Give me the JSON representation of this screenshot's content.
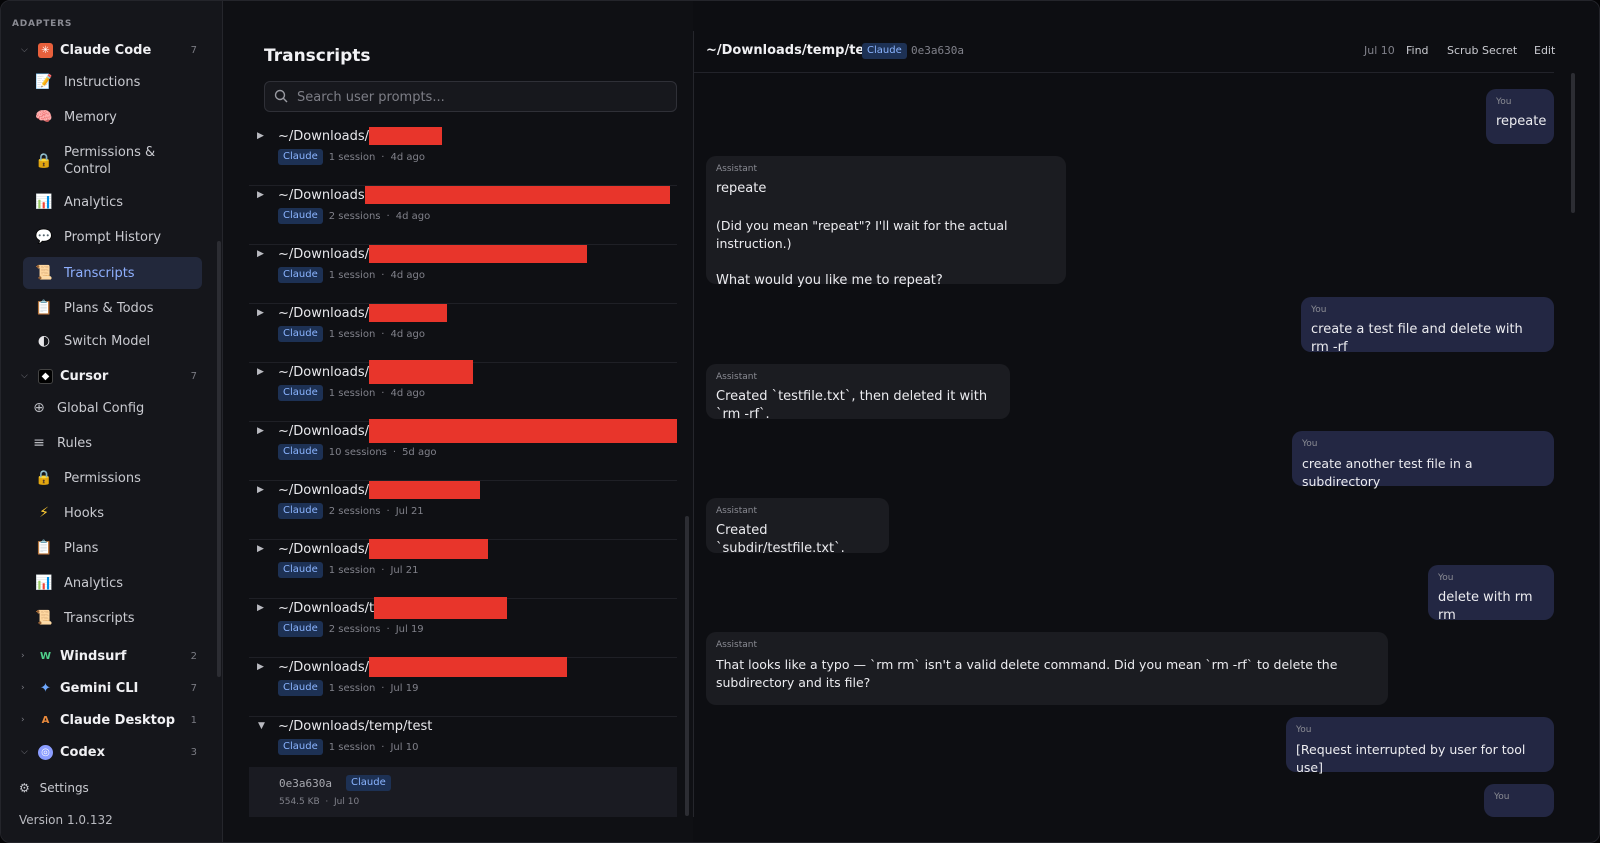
{
  "sidebar": {
    "heading": "ADAPTERS",
    "groups": [
      {
        "label": "Claude Code",
        "count": "7",
        "icon": "claude-code-icon",
        "color": "#e8603c"
      },
      {
        "label": "Cursor",
        "count": "7",
        "icon": "cursor-icon",
        "color": "#ffffff"
      },
      {
        "label": "Windsurf",
        "count": "2",
        "icon": "windsurf-icon",
        "color": "#4fd08b"
      },
      {
        "label": "Gemini CLI",
        "count": "7",
        "icon": "gemini-icon",
        "color": "#6ea8ff"
      },
      {
        "label": "Claude Desktop",
        "count": "1",
        "icon": "claude-desktop-icon",
        "color": "#e98a3c"
      },
      {
        "label": "Codex",
        "count": "3",
        "icon": "codex-icon",
        "color": "#8b9dff"
      }
    ],
    "claude_items": [
      {
        "label": "Instructions",
        "icon": "memo-icon"
      },
      {
        "label": "Memory",
        "icon": "brain-icon"
      },
      {
        "label": "Permissions & Control",
        "icon": "lock-icon"
      },
      {
        "label": "Analytics",
        "icon": "bar-chart-icon"
      },
      {
        "label": "Prompt History",
        "icon": "speech-bubble-icon"
      },
      {
        "label": "Transcripts",
        "icon": "scroll-icon"
      },
      {
        "label": "Plans & Todos",
        "icon": "clipboard-icon"
      },
      {
        "label": "Switch Model",
        "icon": "half-circle-icon"
      }
    ],
    "cursor_items": [
      {
        "label": "Global Config",
        "icon": "plus-circle-icon"
      },
      {
        "label": "Rules",
        "icon": "list-icon"
      },
      {
        "label": "Permissions",
        "icon": "lock-icon"
      },
      {
        "label": "Hooks",
        "icon": "lightning-icon"
      },
      {
        "label": "Plans",
        "icon": "clipboard-icon"
      },
      {
        "label": "Analytics",
        "icon": "bar-chart-icon"
      },
      {
        "label": "Transcripts",
        "icon": "scroll-icon"
      }
    ],
    "settings_label": "Settings",
    "version": "Version 1.0.132"
  },
  "transcripts": {
    "title": "Transcripts",
    "search_placeholder": "Search user prompts...",
    "items": [
      {
        "path": "~/Downloads/",
        "badge": "Claude",
        "sessions": "1 session",
        "when": "4d ago"
      },
      {
        "path": "~/Downloads",
        "badge": "Claude",
        "sessions": "2 sessions",
        "when": "4d ago"
      },
      {
        "path": "~/Downloads/",
        "badge": "Claude",
        "sessions": "1 session",
        "when": "4d ago"
      },
      {
        "path": "~/Downloads/",
        "badge": "Claude",
        "sessions": "1 session",
        "when": "4d ago"
      },
      {
        "path": "~/Downloads/",
        "badge": "Claude",
        "sessions": "1 session",
        "when": "4d ago"
      },
      {
        "path": "~/Downloads/",
        "badge": "Claude",
        "sessions": "10 sessions",
        "when": "5d ago"
      },
      {
        "path": "~/Downloads/",
        "badge": "Claude",
        "sessions": "2 sessions",
        "when": "Jul 21"
      },
      {
        "path": "~/Downloads/",
        "badge": "Claude",
        "sessions": "1 session",
        "when": "Jul 21"
      },
      {
        "path": "~/Downloads/t",
        "badge": "Claude",
        "sessions": "2 sessions",
        "when": "Jul 19"
      },
      {
        "path": "~/Downloads/",
        "badge": "Claude",
        "sessions": "1 session",
        "when": "Jul 19"
      },
      {
        "path": "~/Downloads/temp/test",
        "badge": "Claude",
        "sessions": "1 session",
        "when": "Jul 10"
      }
    ],
    "session": {
      "id": "0e3a630a",
      "badge": "Claude",
      "size": "554.5 KB",
      "date": "Jul 10"
    }
  },
  "chat": {
    "path": "~/Downloads/temp/test",
    "badge": "Claude",
    "id": "0e3a630a",
    "date": "Jul 10",
    "buttons": {
      "find": "Find",
      "scrub": "Scrub Secret",
      "edit": "Edit"
    },
    "messages": [
      {
        "role": "You",
        "text": "repeate"
      },
      {
        "role": "Assistant",
        "text": "repeate"
      },
      {
        "role": "Assistant",
        "text": "(Did you mean \"repeat\"? I'll wait for the actual instruction.)"
      },
      {
        "role": "Assistant",
        "text": "What would you like me to repeat?"
      },
      {
        "role": "You",
        "text": "create a test file and delete with rm -rf"
      },
      {
        "role": "Assistant",
        "text": "Created `testfile.txt`, then deleted it with `rm -rf`."
      },
      {
        "role": "You",
        "text": "create another test file in a subdirectory"
      },
      {
        "role": "Assistant",
        "text": "Created `subdir/testfile.txt`."
      },
      {
        "role": "You",
        "text": "delete with rm rm"
      },
      {
        "role": "Assistant",
        "text": "That looks like a typo — `rm rm` isn't a valid delete command. Did you mean `rm -rf` to delete the subdirectory and its file?"
      },
      {
        "role": "You",
        "text": "[Request interrupted by user for tool use]"
      },
      {
        "role": "You",
        "text": ""
      }
    ]
  },
  "colors": {
    "accent": "#8fb0ff",
    "redaction": "#e8352b",
    "user_bubble": "#232743",
    "assistant_bubble": "#1b1c21"
  }
}
